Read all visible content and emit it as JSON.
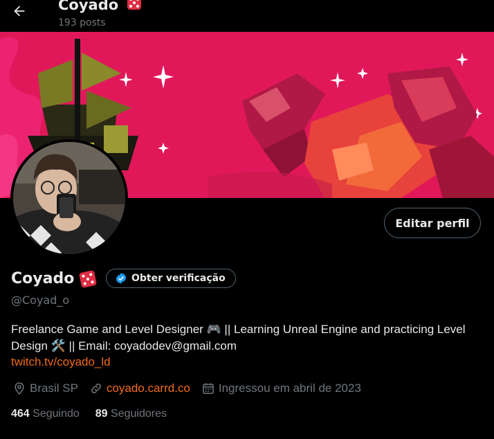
{
  "header": {
    "title": "Coyado",
    "title_emoji": "dice-icon",
    "posts": "193 posts"
  },
  "profile": {
    "name": "Coyado",
    "verify_label": "Obter verificação",
    "handle": "@Coyad_o",
    "edit_label": "Editar perfil",
    "bio_line1": "Freelance Game and Level Designer 🎮 || Learning Unreal Engine and practicing Level",
    "bio_line2": "Design 🛠️ || Email: coyadodev@gmail.com",
    "bio_link": "twitch.tv/coyado_ld",
    "location": "Brasil SP",
    "website": "coyado.carrd.co",
    "joined": "Ingressou em abril de 2023",
    "following_count": "464",
    "following_label": "Seguindo",
    "followers_count": "89",
    "followers_label": "Seguidores"
  },
  "colors": {
    "background": "#000000",
    "text": "#e7e9ea",
    "muted": "#71767b",
    "link": "#f26a1c",
    "banner": "#e0185a",
    "verified_blue": "#1d9bf0",
    "dice_red": "#dd2e44"
  }
}
